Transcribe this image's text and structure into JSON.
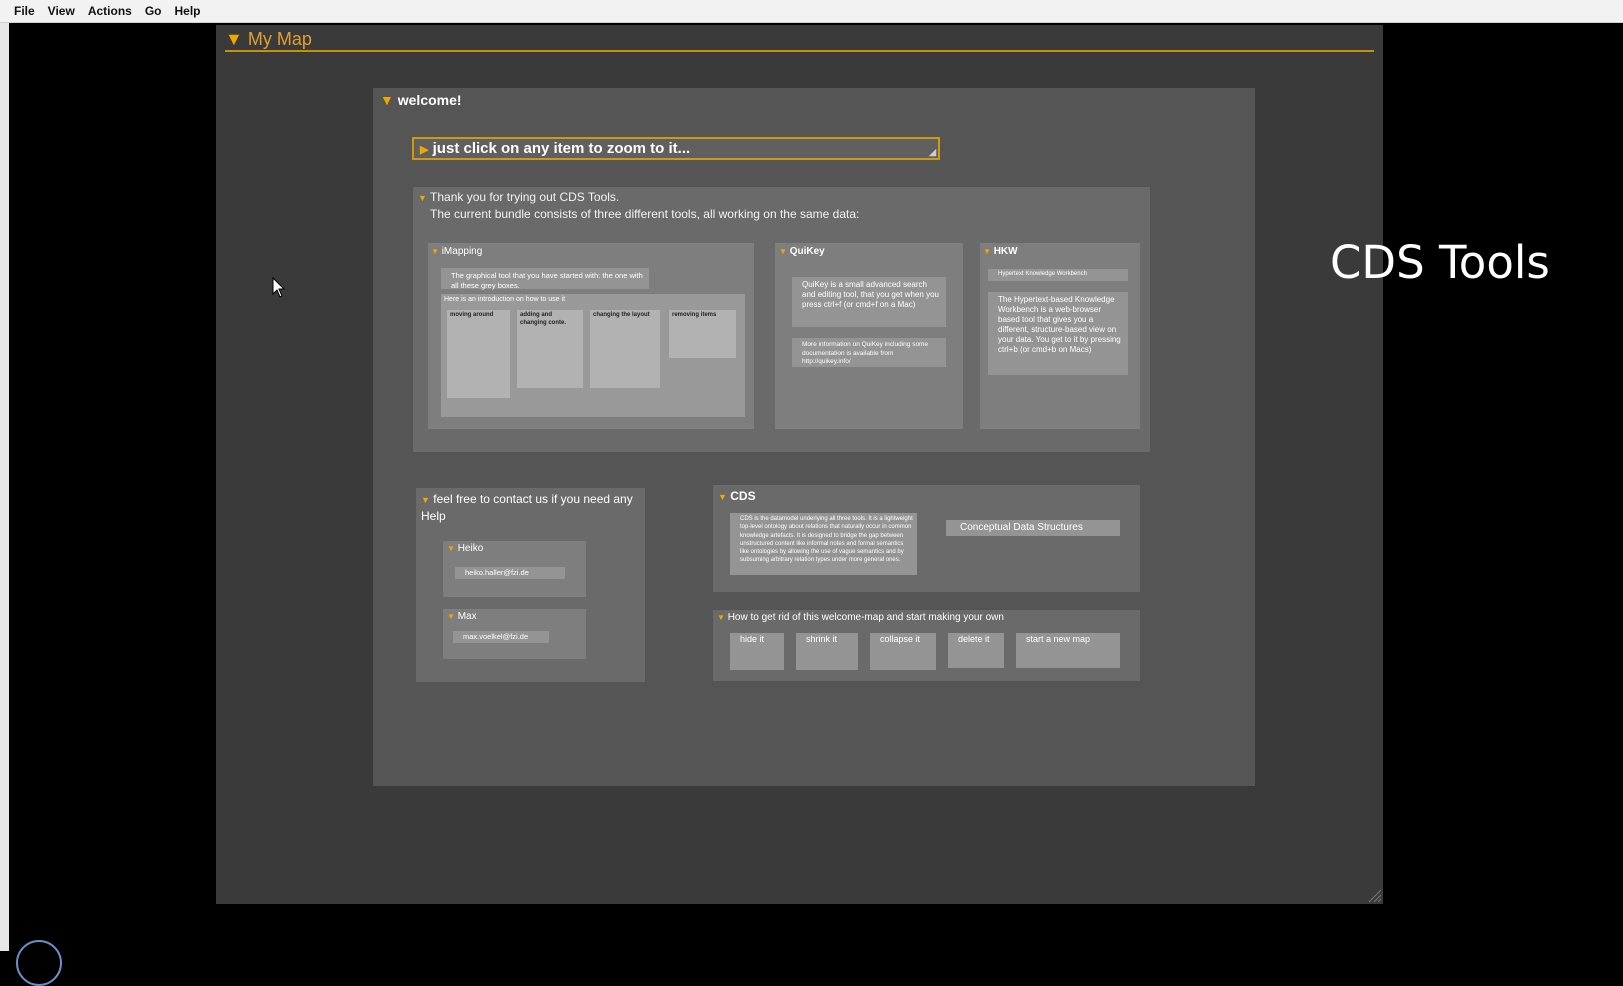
{
  "menu": [
    "File",
    "View",
    "Actions",
    "Go",
    "Help"
  ],
  "map": {
    "title": "My Map"
  },
  "welcome": {
    "title": "welcome!",
    "tip": "just click on any item to zoom to it...",
    "thanks": {
      "line1": "Thank you for trying out CDS Tools.",
      "line2": "The current bundle consists of three different tools, all working on the same data:",
      "imapping": {
        "title": "iMapping",
        "item1": "The graphical tool that you have started with: the one with all these grey boxes.",
        "item2": "Here is an introduction on how to use it",
        "cards": [
          "moving around",
          "adding and changing conte.",
          "changing the layout",
          "removing items"
        ]
      },
      "quikey": {
        "title": "QuiKey",
        "item1": "QuiKey is a small advanced search and editing tool, that you get when you press ctrl+f (or cmd+f on a Mac)",
        "item2": "More information on QuiKey including some documentation is available from http://quikey.info/"
      },
      "hkw": {
        "title": "HKW",
        "item1": "Hypertext Knowledge Workbench",
        "item2": "The Hypertext-based Knowledge Workbench is a web-browser based tool that gives you a different, structure-based view on your data. You get to it by pressing ctrl+b (or cmd+b on Macs)"
      }
    },
    "contact": {
      "title": "feel free to contact us if you need any Help",
      "people": [
        {
          "name": "Heiko",
          "email": "heiko.haller@fzi.de"
        },
        {
          "name": "Max",
          "email": "max.voelkel@fzi.de"
        }
      ]
    },
    "cds": {
      "title": "CDS",
      "text": "CDS is the datamodel underlying all three tools. It is a lightweight top-level ontology about relations that naturally occur in common knowledge artefacts. It is designed to bridge the gap between unstructured content like informal notes and formal semantics like ontologies by allowing the use of vague semantics and by subsuming arbitrary relation types under more general ones.",
      "link": "Conceptual Data Structures"
    },
    "howto": {
      "title": "How to get rid of this welcome-map and start making your own",
      "steps": [
        "hide it",
        "shrink it",
        "collapse it",
        "delete it",
        "start a new map"
      ]
    }
  },
  "overlay": {
    "title": "CDS Tools"
  },
  "colors": {
    "accent": "#f0a800",
    "background": "#000000",
    "box": "#555555"
  }
}
